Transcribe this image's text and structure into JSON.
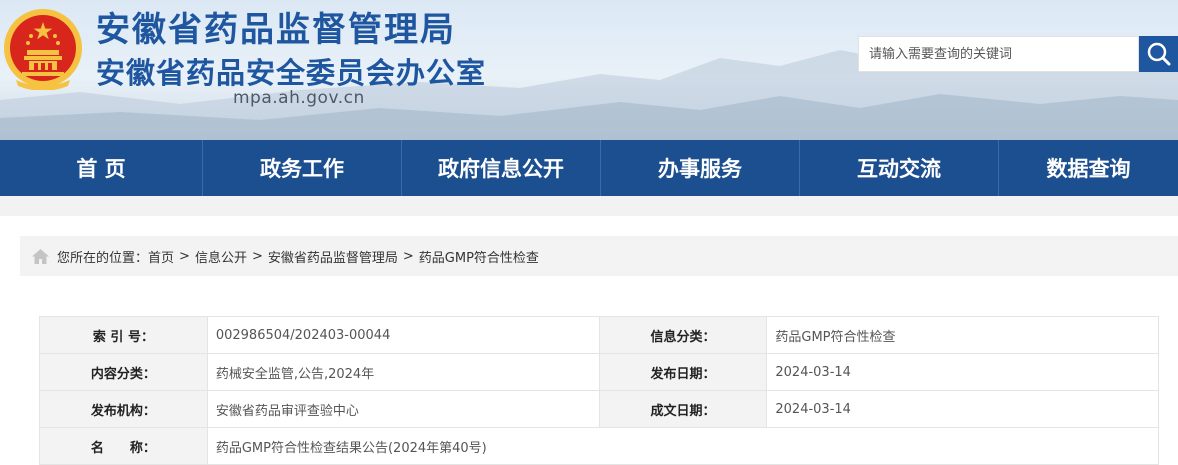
{
  "header": {
    "title_main": "安徽省药品监督管理局",
    "title_sub": "安徽省药品安全委员会办公室",
    "domain": "mpa.ah.gov.cn"
  },
  "search": {
    "placeholder": "请输入需要查询的关键词",
    "icon": "search-icon"
  },
  "nav": {
    "items": [
      {
        "label": "首 页"
      },
      {
        "label": "政务工作"
      },
      {
        "label": "政府信息公开"
      },
      {
        "label": "办事服务"
      },
      {
        "label": "互动交流"
      },
      {
        "label": "数据查询"
      }
    ]
  },
  "breadcrumb": {
    "icon": "home-icon",
    "prefix": "您所在的位置：",
    "items": [
      "首页",
      "信息公开",
      "安徽省药品监督管理局",
      "药品GMP符合性检查"
    ],
    "separator": ">"
  },
  "info": {
    "index_label": "索 引 号：",
    "index_value": "002986504/202403-00044",
    "category_label": "信息分类：",
    "category_value": "药品GMP符合性检查",
    "content_label": "内容分类：",
    "content_value": "药械安全监管,公告,2024年",
    "publish_label": "发布日期：",
    "publish_value": "2024-03-14",
    "org_label": "发布机构：",
    "org_value": "安徽省药品审评查验中心",
    "created_label": "成文日期：",
    "created_value": "2024-03-14",
    "name_label": "名　　称：",
    "name_value": "药品GMP符合性检查结果公告(2024年第40号)"
  },
  "colors": {
    "brand_blue": "#1f56a0",
    "nav_blue": "#1c4f8f",
    "emblem_red": "#d8261c",
    "emblem_gold": "#f5c242"
  }
}
